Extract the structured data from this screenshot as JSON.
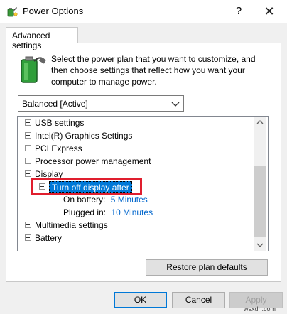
{
  "window": {
    "title": "Power Options",
    "help_glyph": "?",
    "close_glyph": "✕",
    "app_icon": "power-options-icon"
  },
  "tab": {
    "label": "Advanced settings"
  },
  "description": "Select the power plan that you want to customize, and then choose settings that reflect how you want your computer to manage power.",
  "plan_select": {
    "value": "Balanced [Active]"
  },
  "tree": {
    "items": [
      {
        "label": "USB settings",
        "expanded": false
      },
      {
        "label": "Intel(R) Graphics Settings",
        "expanded": false
      },
      {
        "label": "PCI Express",
        "expanded": false
      },
      {
        "label": "Processor power management",
        "expanded": false
      },
      {
        "label": "Display",
        "expanded": true
      },
      {
        "label": "Turn off display after",
        "expanded": true,
        "selected": true
      },
      {
        "label": "On battery:",
        "value": "5 Minutes"
      },
      {
        "label": "Plugged in:",
        "value": "10 Minutes"
      },
      {
        "label": "Multimedia settings",
        "expanded": false
      },
      {
        "label": "Battery",
        "expanded": false
      }
    ]
  },
  "buttons": {
    "restore": "Restore plan defaults",
    "ok": "OK",
    "cancel": "Cancel",
    "apply": "Apply"
  },
  "watermark": "wsxdn.com",
  "colors": {
    "selection": "#0078d7",
    "highlight_box": "#e01e2e",
    "link": "#0066cc"
  }
}
